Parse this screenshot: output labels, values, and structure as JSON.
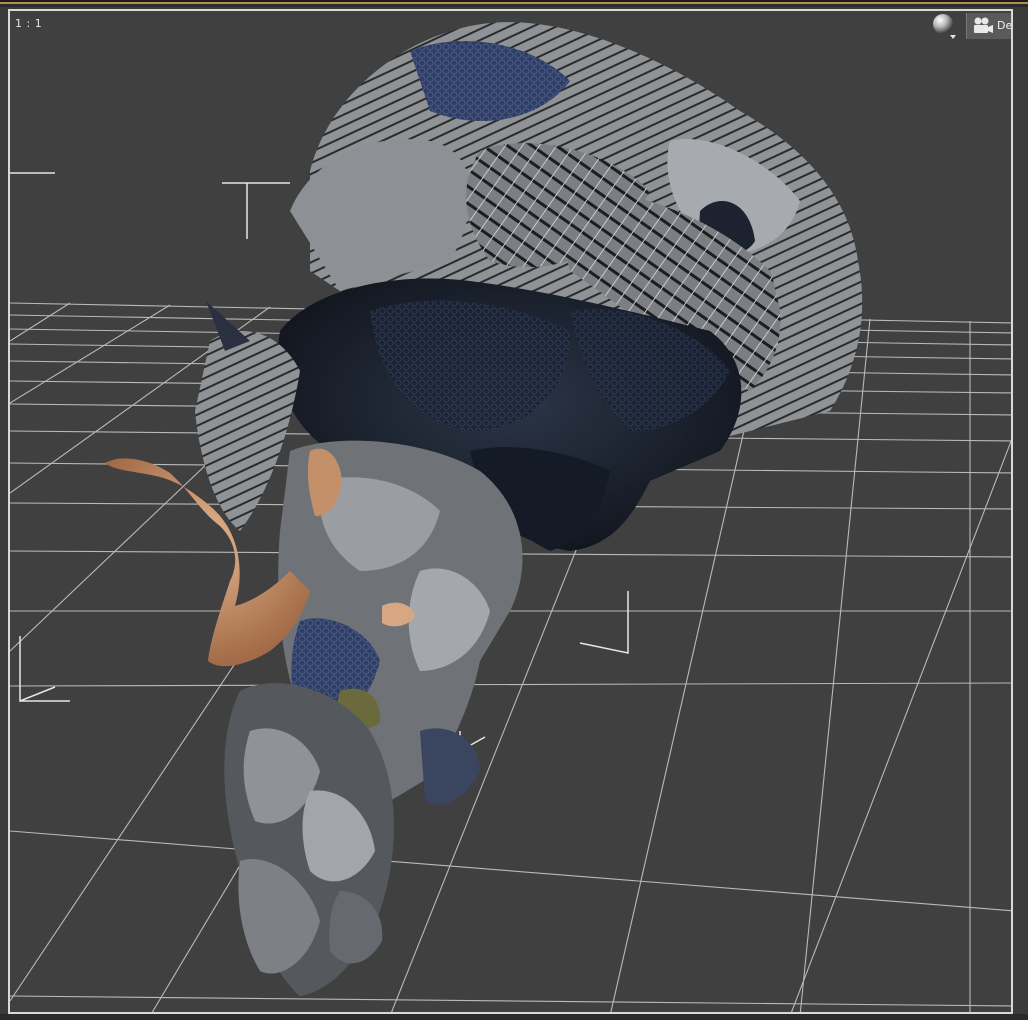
{
  "viewport": {
    "aspect_ratio_label": "1 : 1",
    "camera_label": "Defau",
    "render_mode_icon": "sphere-shading-icon",
    "camera_icon": "camera-icon"
  },
  "colors": {
    "background": "#404040",
    "grid": "#d9d9d9",
    "frame": "#d9d9d9",
    "accent_strip": "#b08e4a"
  }
}
